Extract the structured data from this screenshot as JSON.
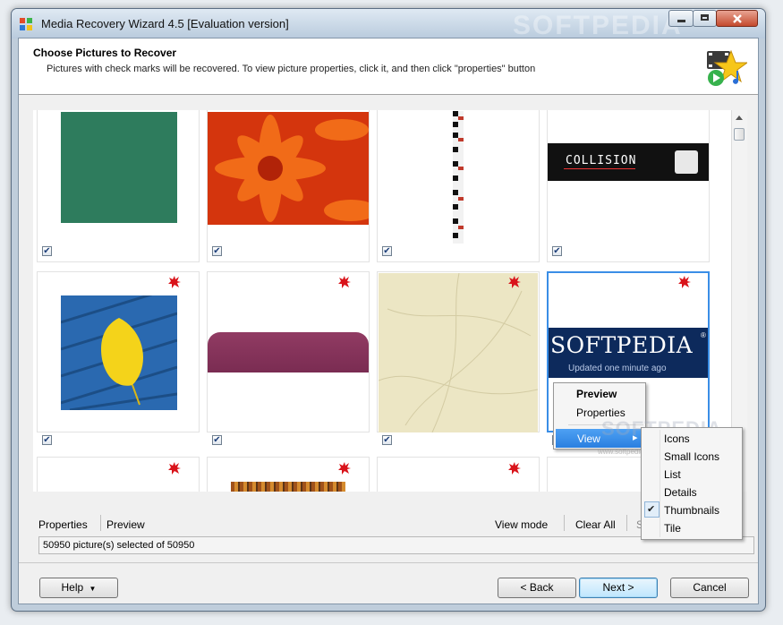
{
  "window": {
    "title": "Media Recovery Wizard 4.5 [Evaluation version]",
    "watermark": "SOFTPEDIA"
  },
  "header": {
    "title": "Choose Pictures to Recover",
    "subtitle": "Pictures with check marks will be recovered. To view picture properties, click it, and then click \"properties\" button"
  },
  "thumbnails": [
    {
      "label": "green-square",
      "checked": true
    },
    {
      "label": "orange-flower",
      "checked": true
    },
    {
      "label": "piano-strip",
      "checked": true
    },
    {
      "label": "collision-banner",
      "checked": true,
      "text": "COLLISION"
    },
    {
      "label": "yellow-leaf",
      "checked": true
    },
    {
      "label": "purple-tab",
      "checked": true
    },
    {
      "label": "beige-texture",
      "checked": true
    },
    {
      "label": "softpedia-logo",
      "checked": true,
      "text": "SOFTPEDIA",
      "subtext": "Updated one minute ago",
      "reg": "®"
    }
  ],
  "toolbar": {
    "properties": "Properties",
    "preview": "Preview",
    "view_mode": "View mode",
    "clear_all": "Clear All",
    "select_all_partial": "S"
  },
  "status": {
    "text": "50950 picture(s) selected of 50950"
  },
  "context_menu": {
    "preview": "Preview",
    "properties": "Properties",
    "view": "View",
    "submenu_arrow": "▸"
  },
  "view_submenu": {
    "items": [
      "Icons",
      "Small Icons",
      "List",
      "Details",
      "Thumbnails",
      "Tile"
    ],
    "checked": "Thumbnails",
    "check_mark": "✔"
  },
  "watermark_overlay": {
    "text": "SOFTPEDIA",
    "small": "www.softpedia.com"
  },
  "buttons": {
    "help": "Help",
    "help_arrow": "▼",
    "back": "< Back",
    "next": "Next >",
    "cancel": "Cancel"
  },
  "checkbox_mark": "✔",
  "colors": {
    "accent": "#3a8ee6",
    "title_bar": "#b9cbdd",
    "menu_highlight": "#2a7fe0"
  }
}
